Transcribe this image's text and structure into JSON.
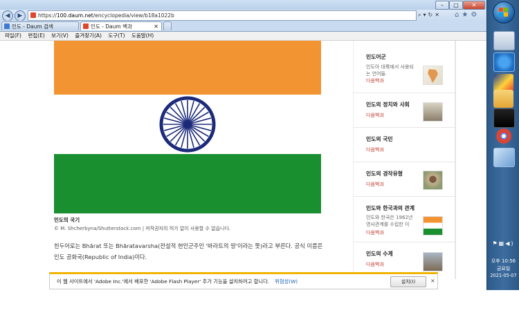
{
  "browser": {
    "address": {
      "scheme": "https://",
      "host": "100.daum.net",
      "path": "/encyclopedia/view/b18a1022b"
    },
    "tabs": [
      {
        "label": "인도 - Daum 검색",
        "active": false
      },
      {
        "label": "인도 - Daum 백과",
        "active": true
      }
    ],
    "menu": [
      "파일(F)",
      "편집(E)",
      "보기(V)",
      "즐겨찾기(A)",
      "도구(T)",
      "도움말(H)"
    ]
  },
  "article": {
    "flag_colors": {
      "saffron": "#f39433",
      "white": "#ffffff",
      "green": "#1a8f30",
      "chakra": "#1c2a7a"
    },
    "caption_title": "인도의 국기",
    "caption_credit": "© M. Shcherbyna/Shutterstock.com | 저작권자의 허가 없이 사용할 수 없습니다.",
    "paragraph": "힌두어로는 Bhārat 또는 Bhāratavarsha(전설적 현인군주인 '바라트의 땅'이라는 뜻)라고 부른다. 공식 이름은 인도 공화국(Republic of India)이다."
  },
  "sidebar": {
    "cards": [
      {
        "title": "인도어군",
        "desc": "인도아 대륙에서 사용되는 언어들.",
        "source": "다음백과"
      },
      {
        "title": "인도의 정치와 사회",
        "desc": "",
        "source": "다음백과"
      },
      {
        "title": "인도의 국민",
        "desc": "",
        "source": "다음백과"
      },
      {
        "title": "인도의 경작유형",
        "desc": "",
        "source": "다음백과"
      },
      {
        "title": "인도와 한국과의 관계",
        "desc": "인도와 한국은 1962년 영사관계를 수립한 이",
        "source": "다음백과"
      },
      {
        "title": "인도의 수계",
        "desc": "",
        "source": "다음백과"
      }
    ]
  },
  "infobar": {
    "message": "이 웹 사이트에서 'Adobe Inc.'에서 배포한 'Adobe Flash Player' 추가 기능을 설치하려고 합니다.",
    "link": "위험성(W)",
    "install": "설치(I)",
    "close": "×"
  },
  "taskbar": {
    "time": "오후 10:56",
    "day": "금요일",
    "date": "2021-05-07"
  }
}
